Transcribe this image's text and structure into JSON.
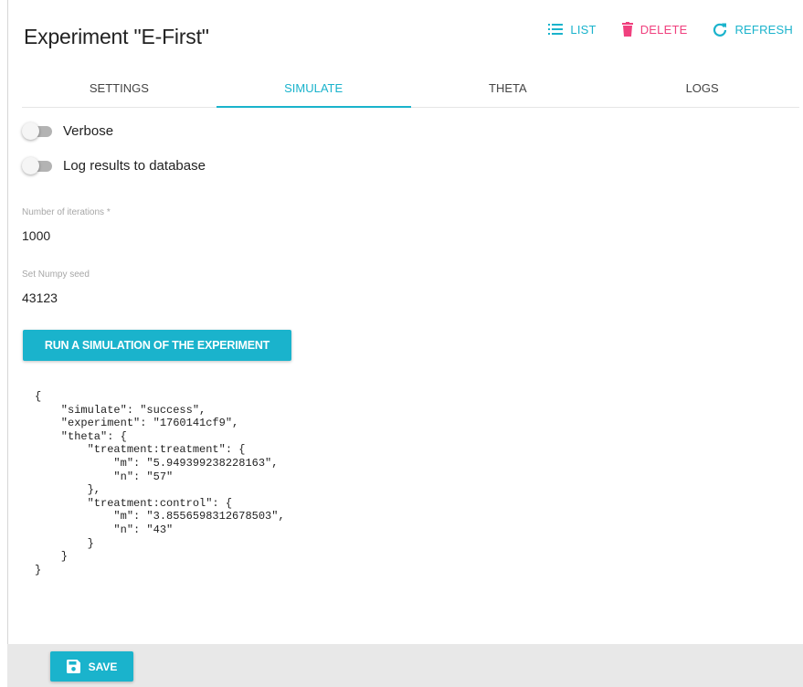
{
  "header": {
    "title": "Experiment \"E-First\""
  },
  "actions": {
    "list_label": "LIST",
    "delete_label": "DELETE",
    "refresh_label": "REFRESH",
    "icons": {
      "list": "list-icon",
      "delete": "trash-icon",
      "refresh": "refresh-icon"
    }
  },
  "tabs": [
    {
      "label": "SETTINGS",
      "active": false
    },
    {
      "label": "SIMULATE",
      "active": true
    },
    {
      "label": "THETA",
      "active": false
    },
    {
      "label": "LOGS",
      "active": false
    }
  ],
  "toggles": {
    "verbose": {
      "label": "Verbose",
      "on": false
    },
    "log_results": {
      "label": "Log results to database",
      "on": false
    }
  },
  "fields": {
    "iterations": {
      "label": "Number of iterations *",
      "value": "1000"
    },
    "seed": {
      "label": "Set Numpy seed",
      "value": "43123"
    }
  },
  "run_button": {
    "label": "RUN A SIMULATION OF THE EXPERIMENT"
  },
  "output": {
    "text": "{\n    \"simulate\": \"success\",\n    \"experiment\": \"1760141cf9\",\n    \"theta\": {\n        \"treatment:treatment\": {\n            \"m\": \"5.949399238228163\",\n            \"n\": \"57\"\n        },\n        \"treatment:control\": {\n            \"m\": \"3.8556598312678503\",\n            \"n\": \"43\"\n        }\n    }\n}"
  },
  "footer": {
    "save_label": "SAVE",
    "icon": "save-icon"
  },
  "colors": {
    "accent": "#1ab3cc",
    "danger": "#f0407e",
    "footer_bg": "#e8e8e8"
  }
}
